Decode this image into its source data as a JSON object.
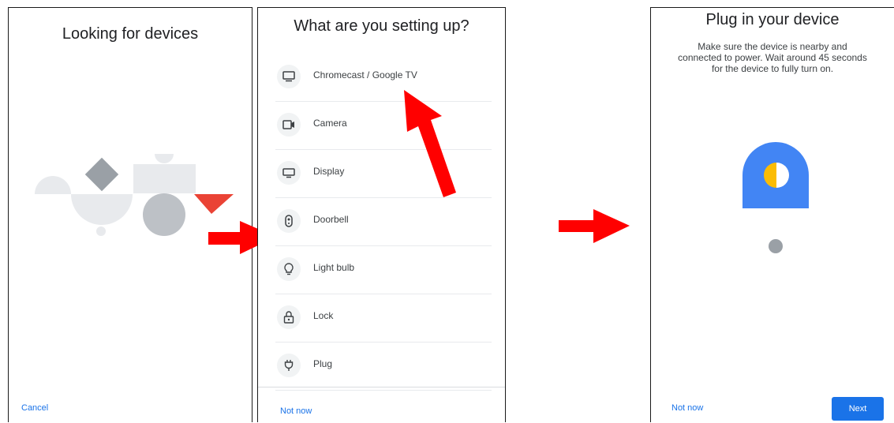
{
  "screen1": {
    "title": "Looking for devices",
    "cancel_label": "Cancel"
  },
  "screen2": {
    "title": "What are you setting up?",
    "items": [
      {
        "label": "Chromecast / Google TV",
        "icon": "tv-icon"
      },
      {
        "label": "Camera",
        "icon": "camera-icon"
      },
      {
        "label": "Display",
        "icon": "display-icon"
      },
      {
        "label": "Doorbell",
        "icon": "doorbell-icon"
      },
      {
        "label": "Light bulb",
        "icon": "light-bulb-icon"
      },
      {
        "label": "Lock",
        "icon": "lock-icon"
      },
      {
        "label": "Plug",
        "icon": "plug-icon"
      }
    ],
    "not_now_label": "Not now"
  },
  "screen3": {
    "title": "Plug in your device",
    "description": "Make sure the device is nearby and connected to power. Wait around 45 seconds for the device to fully turn on.",
    "not_now_label": "Not now",
    "next_label": "Next"
  },
  "colors": {
    "accent": "#1a73e8",
    "arrow": "#ff0000",
    "device_blue": "#4285f4",
    "device_yellow": "#fbbc04",
    "illustration_red": "#ea4335",
    "illustration_gray": "#9aa0a6"
  }
}
